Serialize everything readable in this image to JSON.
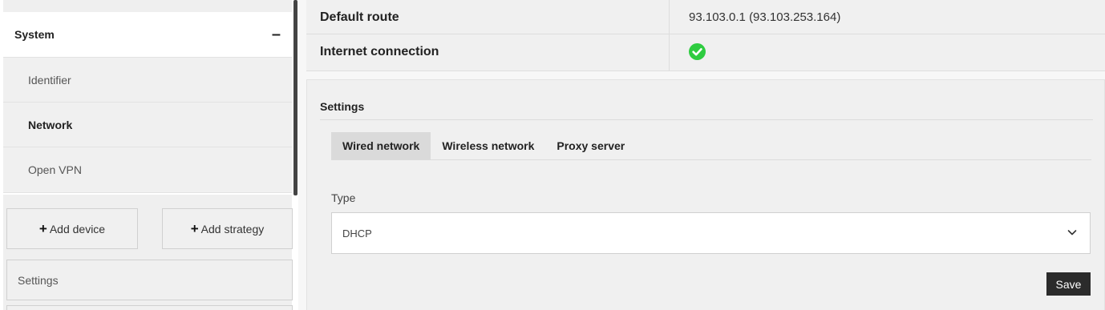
{
  "sidebar": {
    "group": {
      "label": "System",
      "toggle": "–"
    },
    "items": [
      {
        "label": "Identifier"
      },
      {
        "label": "Network"
      },
      {
        "label": "Open VPN"
      }
    ],
    "add_device": {
      "icon": "plus-icon",
      "label": "Add device"
    },
    "add_strategy": {
      "icon": "plus-icon",
      "label": "Add strategy"
    },
    "settings_link": "Settings"
  },
  "info": {
    "rows": [
      {
        "label": "Default route",
        "value": "93.103.0.1 (93.103.253.164)"
      },
      {
        "label": "Internet connection",
        "status_icon": "check-circle-icon",
        "status_color": "#2ecc40"
      }
    ]
  },
  "settings": {
    "title": "Settings",
    "tabs": [
      {
        "label": "Wired network",
        "active": true
      },
      {
        "label": "Wireless network",
        "active": false
      },
      {
        "label": "Proxy server",
        "active": false
      }
    ],
    "type_field": {
      "label": "Type",
      "value": "DHCP",
      "icon": "chevron-down-icon"
    },
    "save_label": "Save"
  },
  "colors": {
    "accent_dark": "#2b2b2b",
    "active_tab": "#dadada",
    "success": "#2ecc40"
  }
}
